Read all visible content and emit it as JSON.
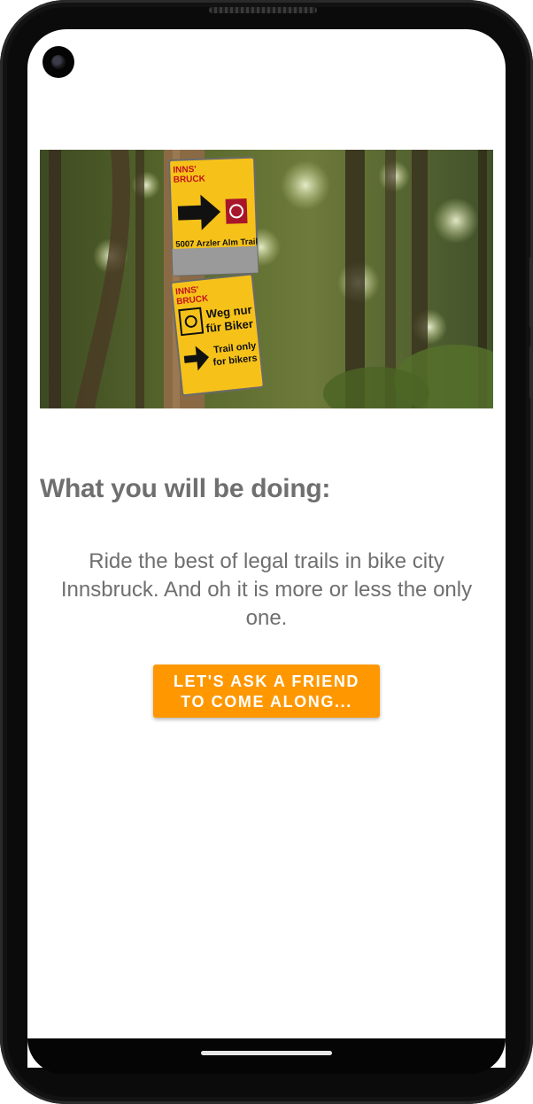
{
  "hero": {
    "image_name": "innsbruck-trail-sign-photo",
    "sign_top": {
      "city": "INNS' BRUCK",
      "trail": "5007 Arzler Alm Trail"
    },
    "sign_bottom": {
      "city": "INNS' BRUCK",
      "line1": "Weg nur",
      "line2": "für Biker",
      "line3": "Trail only",
      "line4": "for bikers"
    }
  },
  "content": {
    "heading": "What you will be doing:",
    "description": "Ride the best of legal trails in bike city Innsbruck. And oh it is more or less the only one."
  },
  "cta": {
    "label": "LET'S ASK A FRIEND TO COME ALONG..."
  },
  "colors": {
    "accent": "#ff9800",
    "text": "#6f6f6f",
    "sign": "#f6c21a"
  }
}
